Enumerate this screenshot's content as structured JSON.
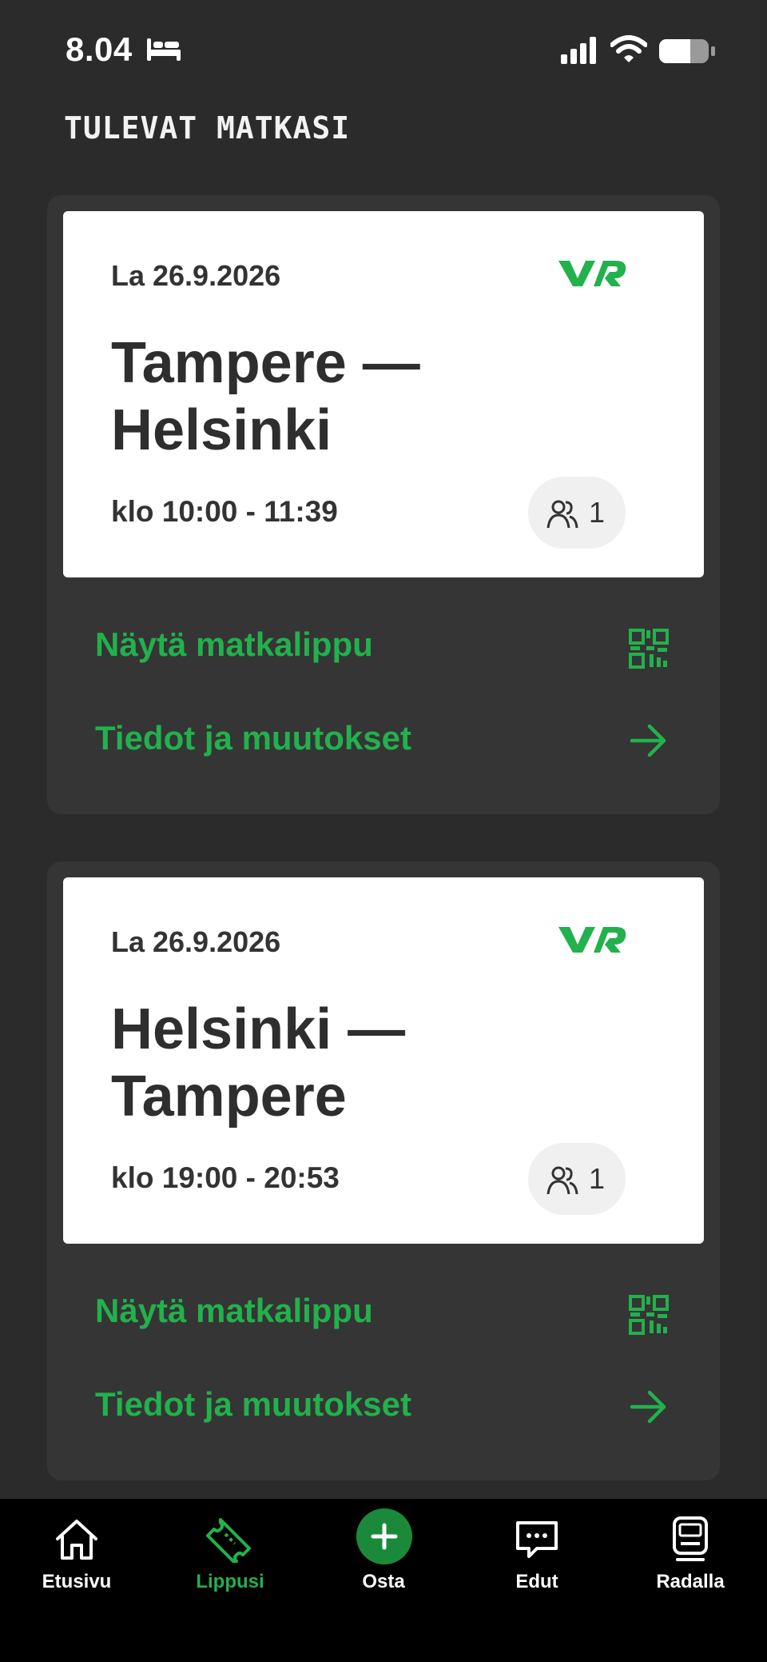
{
  "status_bar": {
    "time": "8.04"
  },
  "section_title": "TULEVAT MATKASI",
  "brand": {
    "accent": "#22b14c",
    "logo_text": "VR"
  },
  "trips": [
    {
      "date": "La 26.9.2026",
      "route": "Tampere — Helsinki",
      "time": "klo 10:00 - 11:39",
      "passengers": "1",
      "show_ticket_label": "Näytä matkalippu",
      "details_label": "Tiedot ja muutokset"
    },
    {
      "date": "La 26.9.2026",
      "route": "Helsinki — Tampere",
      "time": "klo 19:00 - 20:53",
      "passengers": "1",
      "show_ticket_label": "Näytä matkalippu",
      "details_label": "Tiedot ja muutokset"
    }
  ],
  "nav": {
    "items": [
      {
        "label": "Etusivu",
        "icon": "home-icon"
      },
      {
        "label": "Lippusi",
        "icon": "ticket-icon",
        "active": true
      },
      {
        "label": "Osta",
        "icon": "plus-icon"
      },
      {
        "label": "Edut",
        "icon": "chat-bubble-icon"
      },
      {
        "label": "Radalla",
        "icon": "train-icon"
      }
    ]
  }
}
